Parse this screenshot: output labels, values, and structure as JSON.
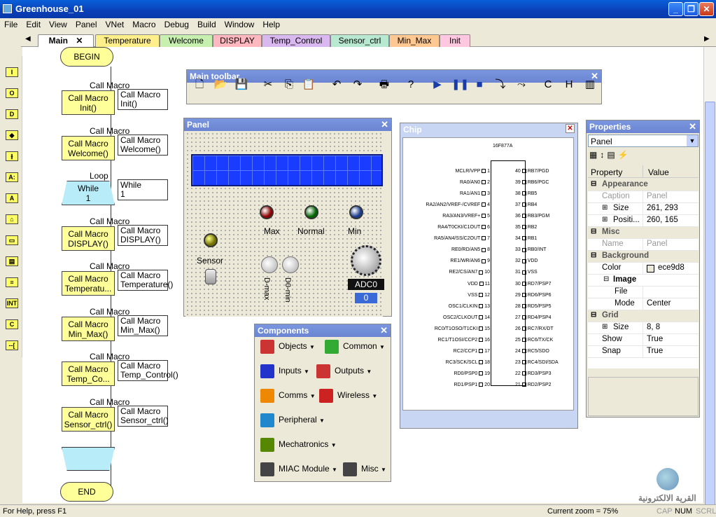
{
  "window": {
    "title": "Greenhouse_01"
  },
  "menu": [
    "File",
    "Edit",
    "View",
    "Panel",
    "VNet",
    "Macro",
    "Debug",
    "Build",
    "Window",
    "Help"
  ],
  "tabs": [
    {
      "label": "Main",
      "color": "#ffffff"
    },
    {
      "label": "Temperature",
      "color": "#ffef8a"
    },
    {
      "label": "Welcome",
      "color": "#c7f0b0"
    },
    {
      "label": "DISPLAY",
      "color": "#ffb8c0"
    },
    {
      "label": "Temp_Control",
      "color": "#d9b8f0"
    },
    {
      "label": "Sensor_ctrl",
      "color": "#b8e8d0"
    },
    {
      "label": "Min_Max",
      "color": "#ffc890"
    },
    {
      "label": "Init",
      "color": "#ffc8e0"
    }
  ],
  "palette": [
    {
      "name": "input-icon",
      "label": "I"
    },
    {
      "name": "output-icon",
      "label": "O"
    },
    {
      "name": "delay-icon",
      "label": "D"
    },
    {
      "name": "decision-icon",
      "label": "◆"
    },
    {
      "name": "switch-icon",
      "label": "⫲"
    },
    {
      "name": "calc-icon",
      "label": "A:"
    },
    {
      "name": "connection-point-icon",
      "label": "A"
    },
    {
      "name": "loop-icon",
      "label": "⌂"
    },
    {
      "name": "macro-icon",
      "label": "▭"
    },
    {
      "name": "component-macro-icon",
      "label": "▤"
    },
    {
      "name": "comment-icon",
      "label": "≡"
    },
    {
      "name": "interrupt-icon",
      "label": "INT"
    },
    {
      "name": "c-code-icon",
      "label": "C"
    },
    {
      "name": "comment-bracket-icon",
      "label": "--["
    }
  ],
  "flowchart": {
    "begin": "BEGIN",
    "end": "END",
    "blocks": [
      {
        "title": "Call Macro",
        "body": "Call Macro\nInit()",
        "note": "Call Macro\nInit()"
      },
      {
        "title": "Call Macro",
        "body": "Call Macro\nWelcome()",
        "note": "Call Macro\nWelcome()"
      },
      {
        "title": "Loop",
        "body": "While\n1",
        "note": "While\n1"
      },
      {
        "title": "Call Macro",
        "body": "Call Macro\nDISPLAY()",
        "note": "Call Macro\nDISPLAY()"
      },
      {
        "title": "Call Macro",
        "body": "Call Macro\nTemperatu...",
        "note": "Call Macro\nTemperature()"
      },
      {
        "title": "Call Macro",
        "body": "Call Macro\nMin_Max()",
        "note": "Call Macro\nMin_Max()"
      },
      {
        "title": "Call Macro",
        "body": "Call Macro\nTemp_Co...",
        "note": "Call Macro\nTemp_Control()"
      },
      {
        "title": "Call Macro",
        "body": "Call Macro\nSensor_ctrl()",
        "note": "Call Macro\nSensor_ctrl()"
      }
    ]
  },
  "toolbar": {
    "title": "Main toolbar"
  },
  "panel": {
    "title": "Panel",
    "leds": [
      {
        "label": "Max",
        "color": "#8b0000"
      },
      {
        "label": "Normal",
        "color": "#006400"
      },
      {
        "label": "Min",
        "color": "#1a3a8a"
      }
    ],
    "sensor_label": "Sensor",
    "sensor_color": "#707000",
    "buttons": [
      "D-max",
      "D0-min"
    ],
    "adc_label": "ADC0",
    "adc_value": "0"
  },
  "chip": {
    "title": "Chip",
    "part": "16F877A",
    "left_pins": [
      [
        "MCLR/VPP",
        "1"
      ],
      [
        "RA0/AN0",
        "2"
      ],
      [
        "RA1/AN1",
        "3"
      ],
      [
        "RA2/AN2/VREF-/CVREF",
        "4"
      ],
      [
        "RA3/AN3/VREF+",
        "5"
      ],
      [
        "RA4/T0CKI/C1OUT",
        "6"
      ],
      [
        "RA5/AN4/SS/C2OUT",
        "7"
      ],
      [
        "RE0/RD/AN5",
        "8"
      ],
      [
        "RE1/WR/AN6",
        "9"
      ],
      [
        "RE2/CS/AN7",
        "10"
      ],
      [
        "VDD",
        "11"
      ],
      [
        "VSS",
        "12"
      ],
      [
        "OSC1/CLKIN",
        "13"
      ],
      [
        "OSC2/CLKOUT",
        "14"
      ],
      [
        "RC0/T1OSO/T1CKI",
        "15"
      ],
      [
        "RC1/T1OSI/CCP2",
        "16"
      ],
      [
        "RC2/CCP1",
        "17"
      ],
      [
        "RC3/SCK/SCL",
        "18"
      ],
      [
        "RD0/PSP0",
        "19"
      ],
      [
        "RD1/PSP1",
        "20"
      ]
    ],
    "right_pins": [
      [
        "40",
        "RB7/PGD"
      ],
      [
        "39",
        "RB6/PGC"
      ],
      [
        "38",
        "RB5"
      ],
      [
        "37",
        "RB4"
      ],
      [
        "36",
        "RB3/PGM"
      ],
      [
        "35",
        "RB2"
      ],
      [
        "34",
        "RB1"
      ],
      [
        "33",
        "RB0/INT"
      ],
      [
        "32",
        "VDD"
      ],
      [
        "31",
        "VSS"
      ],
      [
        "30",
        "RD7/PSP7"
      ],
      [
        "29",
        "RD6/PSP6"
      ],
      [
        "28",
        "RD5/PSP5"
      ],
      [
        "27",
        "RD4/PSP4"
      ],
      [
        "26",
        "RC7/RX/DT"
      ],
      [
        "25",
        "RC6/TX/CK"
      ],
      [
        "24",
        "RC5/SDO"
      ],
      [
        "23",
        "RC4/SDI/SDA"
      ],
      [
        "22",
        "RD3/PSP3"
      ],
      [
        "21",
        "RD2/PSP2"
      ]
    ]
  },
  "components": {
    "title": "Components",
    "items": [
      {
        "label": "Objects",
        "name": "objects-button"
      },
      {
        "label": "Common",
        "name": "common-button"
      },
      {
        "label": "Inputs",
        "name": "inputs-button"
      },
      {
        "label": "Outputs",
        "name": "outputs-button"
      },
      {
        "label": "Comms",
        "name": "comms-button"
      },
      {
        "label": "Wireless",
        "name": "wireless-button"
      },
      {
        "label": "Peripheral",
        "name": "peripheral-button"
      },
      {
        "label": "Mechatronics",
        "name": "mechatronics-button"
      },
      {
        "label": "MIAC Module",
        "name": "miac-module-button"
      },
      {
        "label": "Misc",
        "name": "misc-button"
      }
    ]
  },
  "properties": {
    "title": "Properties",
    "selector": "Panel",
    "col_property": "Property",
    "col_value": "Value",
    "rows": [
      {
        "type": "section",
        "k": "Appearance"
      },
      {
        "type": "ro",
        "k": "Caption",
        "v": "Panel"
      },
      {
        "type": "expand",
        "k": "Size",
        "v": "261, 293"
      },
      {
        "type": "expand",
        "k": "Positi...",
        "v": "260, 165"
      },
      {
        "type": "section",
        "k": "Misc"
      },
      {
        "type": "ro",
        "k": "Name",
        "v": "Panel"
      },
      {
        "type": "section",
        "k": "Background"
      },
      {
        "type": "color",
        "k": "Color",
        "v": "ece9d8"
      },
      {
        "type": "subsection",
        "k": "Image"
      },
      {
        "type": "sub",
        "k": "File",
        "v": ""
      },
      {
        "type": "sub",
        "k": "Mode",
        "v": "Center"
      },
      {
        "type": "section",
        "k": "Grid"
      },
      {
        "type": "expand",
        "k": "Size",
        "v": "8, 8"
      },
      {
        "type": "plain",
        "k": "Show",
        "v": "True"
      },
      {
        "type": "plain",
        "k": "Snap",
        "v": "True"
      }
    ]
  },
  "status": {
    "help": "For Help, press F1",
    "zoom": "Current zoom = 75%",
    "indicators": [
      "CAP",
      "NUM",
      "SCRL"
    ]
  },
  "watermark": "القرية الالكترونية"
}
